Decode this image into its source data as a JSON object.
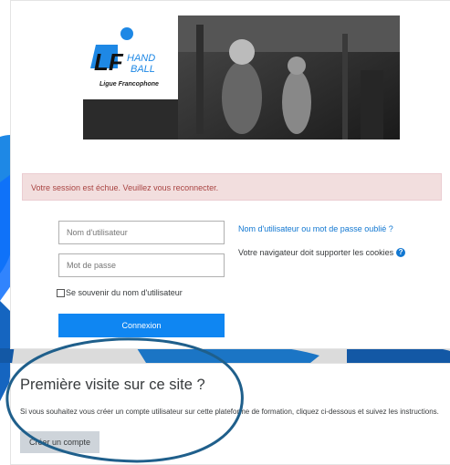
{
  "header": {
    "logo": {
      "text": "LFHANDBALL",
      "subtitle": "Ligue Francophone"
    }
  },
  "login": {
    "alert": "Votre session est échue. Veuillez vous reconnecter.",
    "username_placeholder": "Nom d'utilisateur",
    "password_placeholder": "Mot de passe",
    "remember_label": "Se souvenir du nom d'utilisateur",
    "login_button": "Connexion",
    "forgot_link": "Nom d'utilisateur ou mot de passe oublié ?",
    "cookies_text": "Votre navigateur doit supporter les cookies"
  },
  "first_visit": {
    "title": "Première visite sur ce site ?",
    "text": "Si vous souhaitez vous créer un compte utilisateur sur cette plateforme de formation, cliquez ci-dessous et suivez les instructions.",
    "button": "Créer un compte"
  },
  "colors": {
    "primary": "#0f86f2",
    "alert_bg": "#f2dede",
    "alert_text": "#a94442",
    "annotation": "#1f5f8b"
  }
}
